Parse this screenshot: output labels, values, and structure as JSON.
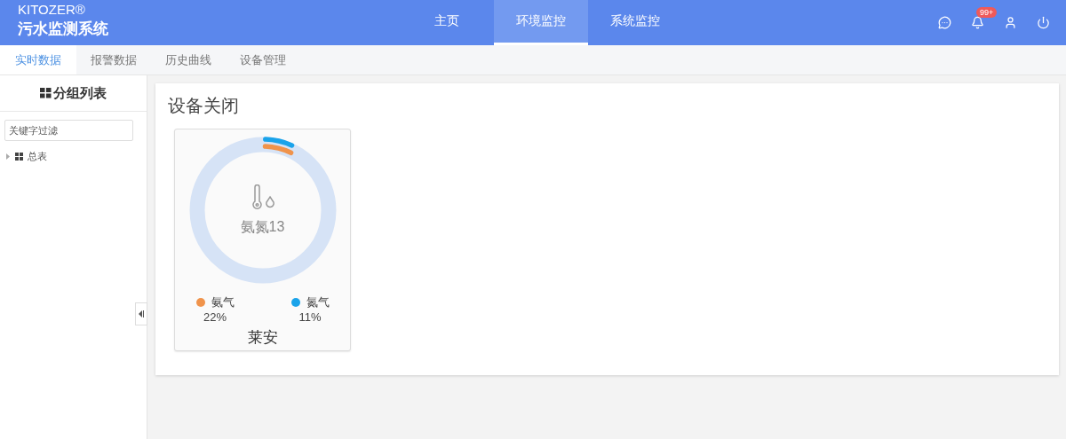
{
  "brand": {
    "name": "KITOZER®",
    "subtitle": "污水监测系统"
  },
  "nav": [
    {
      "label": "主页",
      "selected": false
    },
    {
      "label": "环境监控",
      "selected": true
    },
    {
      "label": "系统监控",
      "selected": false
    }
  ],
  "notifications": {
    "badge": "99+"
  },
  "tabs": [
    {
      "label": "实时数据",
      "selected": true
    },
    {
      "label": "报警数据",
      "selected": false
    },
    {
      "label": "历史曲线",
      "selected": false
    },
    {
      "label": "设备管理",
      "selected": false
    }
  ],
  "sidebar": {
    "title": "分组列表",
    "filter": {
      "placeholder": "关键字过滤"
    },
    "tree": [
      {
        "label": "总表",
        "expanded": false
      }
    ]
  },
  "panel": {
    "title": "设备关闭",
    "devices": [
      {
        "center_label": "氨氮13",
        "name": "莱安",
        "legend": [
          {
            "name": "氨气",
            "value": "22%",
            "color": "#f0934b"
          },
          {
            "name": "氮气",
            "value": "11%",
            "color": "#1aa3ea"
          }
        ]
      }
    ]
  }
}
